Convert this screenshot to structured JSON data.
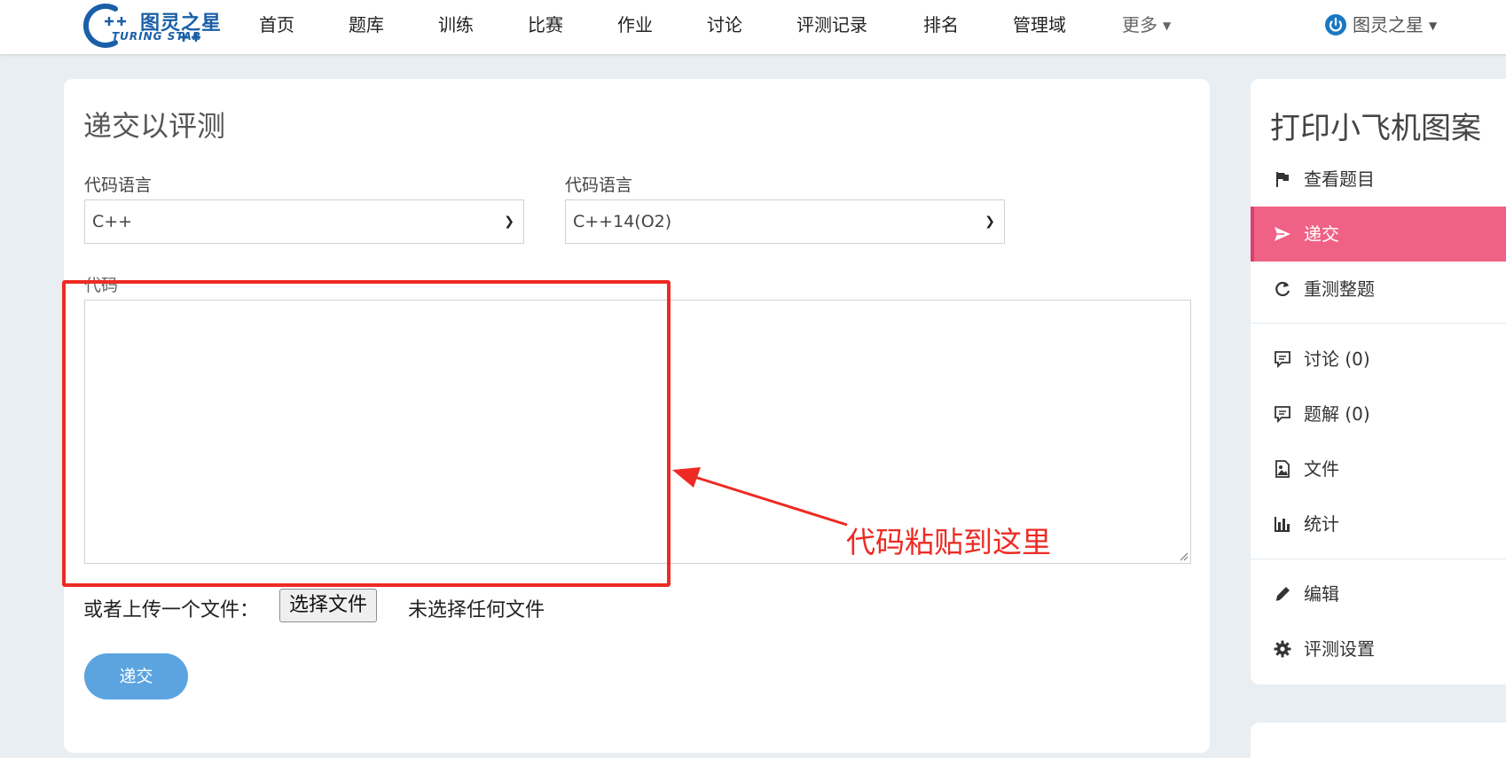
{
  "navbar": {
    "logo": {
      "cn": "图灵之星",
      "en": "TURING STAR"
    },
    "items": [
      {
        "label": "首页"
      },
      {
        "label": "题库"
      },
      {
        "label": "训练"
      },
      {
        "label": "比赛"
      },
      {
        "label": "作业"
      },
      {
        "label": "讨论"
      },
      {
        "label": "评测记录"
      },
      {
        "label": "排名"
      },
      {
        "label": "管理域"
      },
      {
        "label": "更多"
      }
    ],
    "user": "图灵之星"
  },
  "submit_card": {
    "title": "递交以评测",
    "language_label_1": "代码语言",
    "language_value_1": "C++",
    "language_label_2": "代码语言",
    "language_value_2": "C++14(O2)",
    "code_label": "代码",
    "code_value": "",
    "upload_label": "或者上传一个文件：",
    "choose_file_label": "选择文件",
    "file_status": "未选择任何文件",
    "submit_label": "递交"
  },
  "annotation": {
    "text": "代码粘贴到这里",
    "color": "#ee2a24"
  },
  "sidebar": {
    "title": "打印小飞机图案",
    "items": [
      {
        "label": "查看题目",
        "icon": "flag-icon"
      },
      {
        "label": "递交",
        "icon": "send-icon",
        "active": true
      },
      {
        "label": "重测整题",
        "icon": "refresh-icon"
      },
      {
        "label": "讨论 (0)",
        "icon": "comment-icon"
      },
      {
        "label": "题解 (0)",
        "icon": "comment-icon"
      },
      {
        "label": "文件",
        "icon": "image-file-icon"
      },
      {
        "label": "统计",
        "icon": "bar-chart-icon"
      },
      {
        "label": "编辑",
        "icon": "pencil-icon"
      },
      {
        "label": "评测设置",
        "icon": "gear-icon"
      }
    ]
  },
  "colors": {
    "accent_pink": "#ef6185",
    "submit_blue": "#5ba4e0",
    "brand_blue": "#1a5fa8"
  }
}
